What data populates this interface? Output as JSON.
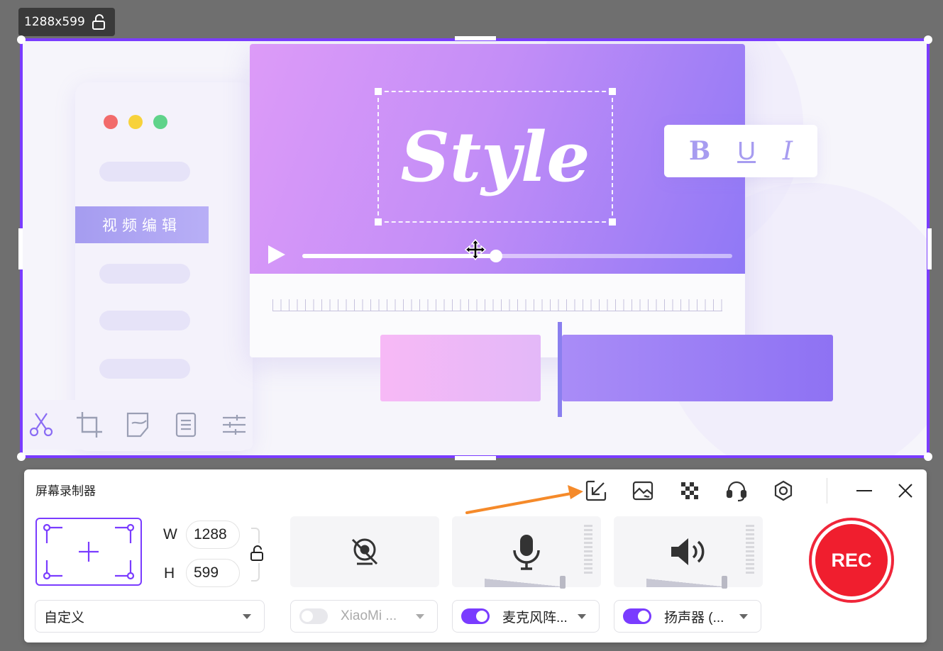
{
  "selection": {
    "size_label": "1288x599",
    "sidebar_label": "视频编辑",
    "style_text": "Style",
    "format_buttons": [
      "B",
      "U",
      "I"
    ],
    "accent_color": "#7a3cff",
    "traffic_light_colors": [
      "#f26b6b",
      "#f7d23b",
      "#5fd38a"
    ],
    "tool_icons": [
      "scissors-icon",
      "crop-icon",
      "sticker-icon",
      "document-icon",
      "sliders-icon"
    ]
  },
  "recorder": {
    "title": "屏幕录制器",
    "toolbar_icons": [
      "export-icon",
      "screenshot-icon",
      "mosaic-icon",
      "headset-icon",
      "settings-icon",
      "minimize-icon",
      "close-icon"
    ],
    "width_label": "W",
    "height_label": "H",
    "width_value": "1288",
    "height_value": "599",
    "region_dropdown": "自定义",
    "camera": {
      "label": "XiaoMi ...",
      "enabled": false,
      "icon": "camera-off-icon"
    },
    "microphone": {
      "label": "麦克风阵...",
      "enabled": true,
      "icon": "microphone-icon"
    },
    "speaker": {
      "label": "扬声器 (...",
      "enabled": true,
      "icon": "speaker-icon"
    },
    "rec_label": "REC",
    "rec_color": "#f01e2e"
  }
}
